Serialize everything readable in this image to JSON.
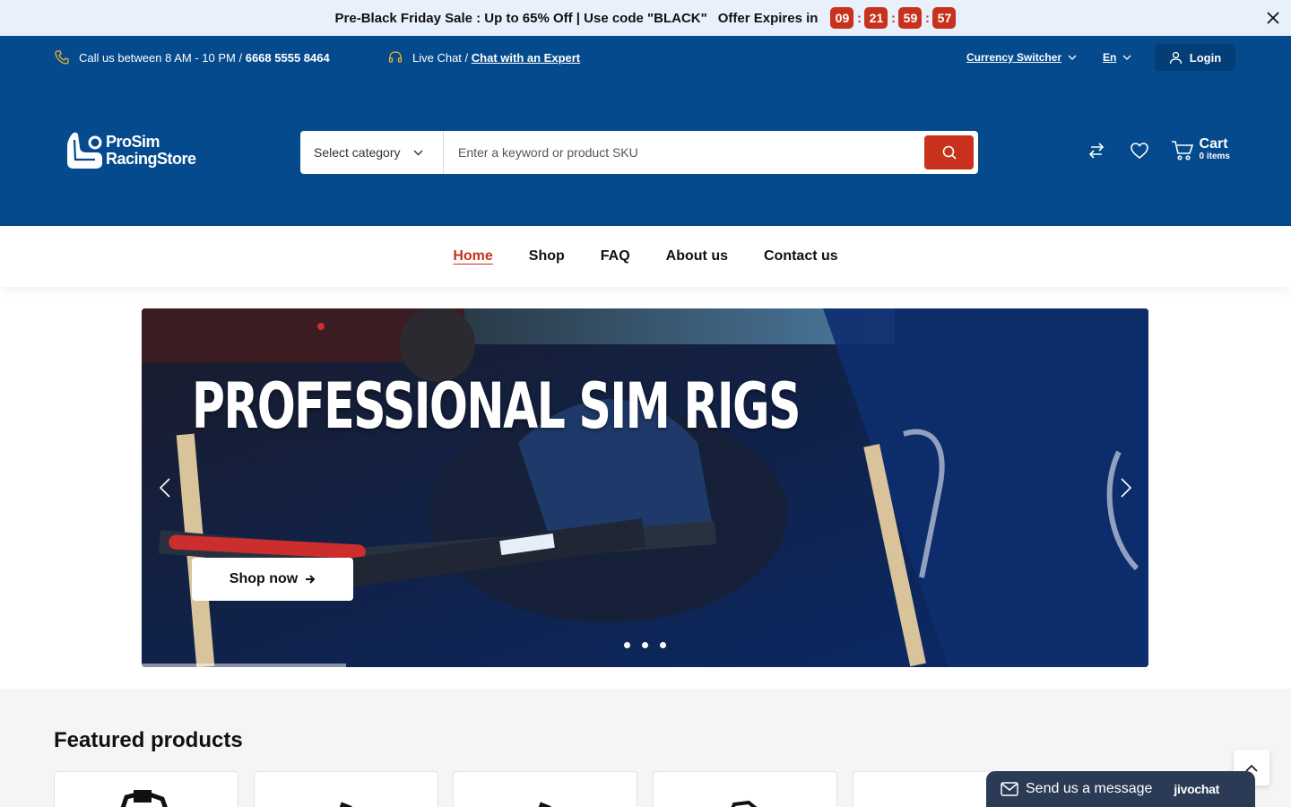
{
  "promo": {
    "text": "Pre-Black Friday Sale : Up to 65% Off | Use code \"BLACK\"",
    "offer_label": "Offer Expires in",
    "timer": [
      "09",
      "21",
      "59",
      "57"
    ],
    "timer_sep": ":"
  },
  "topbar": {
    "call_text": "Call us between 8 AM - 10 PM /",
    "phone": "6668 5555 8464",
    "chat_text": "Live Chat /",
    "chat_link": "Chat with an Expert",
    "currency": "Currency Switcher",
    "language": "En",
    "login": "Login"
  },
  "header": {
    "logo_line1": "ProSim",
    "logo_line2": "RacingStore",
    "search_category": "Select category",
    "search_placeholder": "Enter a keyword or product SKU",
    "cart_label": "Cart",
    "cart_count": "0 items"
  },
  "nav": {
    "items": [
      "Home",
      "Shop",
      "FAQ",
      "About us",
      "Contact us"
    ]
  },
  "hero": {
    "title": "PROFESSIONAL SIM RIGS",
    "cta": "Shop now",
    "slides_count": 3
  },
  "featured": {
    "title": "Featured products"
  },
  "chat_widget": {
    "message": "Send us a message",
    "brand": "jivochat"
  },
  "colors": {
    "primary": "#044a8d",
    "accent": "#c8321c",
    "promo_bg": "#e8f1fb"
  }
}
